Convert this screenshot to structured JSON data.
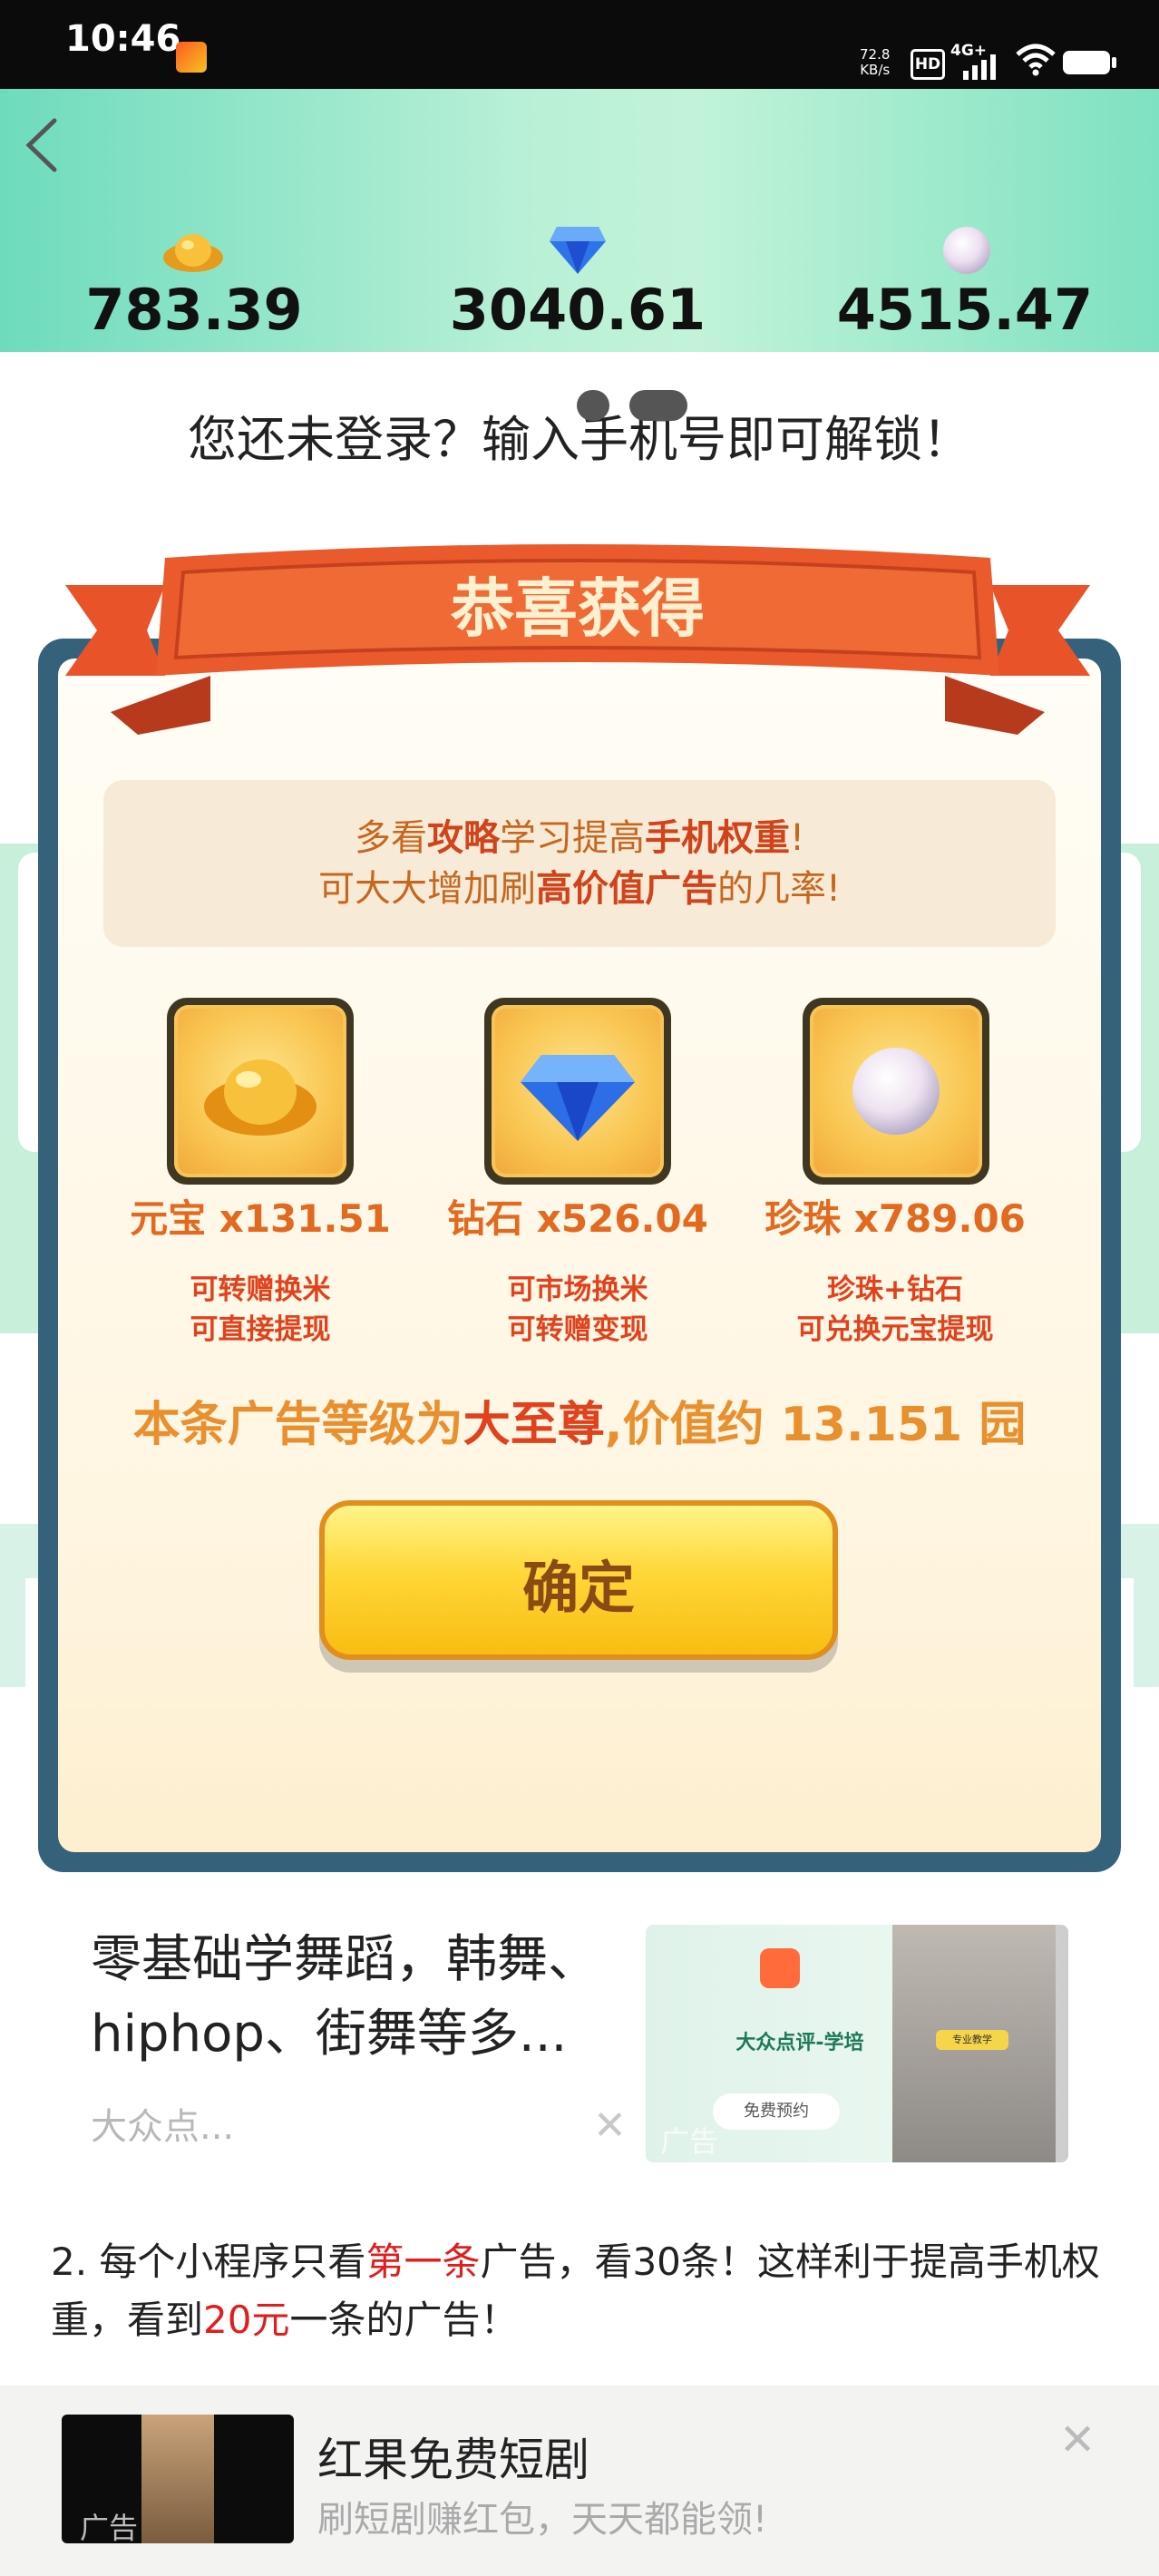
{
  "status_bar": {
    "time": "10:46",
    "net_speed_value": "72.8",
    "net_speed_unit": "KB/s",
    "hd_badge": "HD",
    "network": "4G+",
    "icons": [
      "app-notification-icon",
      "signal-icon",
      "wifi-icon",
      "battery-icon"
    ]
  },
  "header": {
    "back_icon": "chevron-left-icon",
    "balances": [
      {
        "icon": "gold-ingot-icon",
        "value": "783.39"
      },
      {
        "icon": "diamond-icon",
        "value": "3040.61"
      },
      {
        "icon": "pearl-icon",
        "value": "4515.47"
      }
    ],
    "colors": {
      "gradient_start": "#6edbbd",
      "gradient_end": "#7ee1c1"
    }
  },
  "login_prompt": "您还未登录？输入手机号即可解锁！",
  "modal": {
    "title": "恭喜获得",
    "tip_parts": [
      {
        "text": "多看",
        "hl": false
      },
      {
        "text": "攻略",
        "hl": true
      },
      {
        "text": "学习提高",
        "hl": false
      },
      {
        "text": "手机权重",
        "hl": true
      },
      {
        "text": "!",
        "hl": false
      }
    ],
    "tip_parts_2": [
      {
        "text": "可大大增加刷",
        "hl": false
      },
      {
        "text": "高价值广告",
        "hl": true
      },
      {
        "text": "的几率!",
        "hl": false
      }
    ],
    "rewards": [
      {
        "icon": "gold-ingot-icon",
        "name": "元宝",
        "amount": "x131.51",
        "desc1": "可转赠换米",
        "desc2": "可直接提现"
      },
      {
        "icon": "diamond-icon",
        "name": "钻石",
        "amount": "x526.04",
        "desc1": "可市场换米",
        "desc2": "可转赠变现"
      },
      {
        "icon": "pearl-icon",
        "name": "珍珠",
        "amount": "x789.06",
        "desc1": "珍珠+钻石",
        "desc2": "可兑换元宝提现"
      }
    ],
    "value_prefix": "本条广告等级为",
    "value_level": "大至尊",
    "value_suffix": ",价值约 13.151 园",
    "confirm_label": "确定",
    "colors": {
      "frame": "#35617a",
      "ribbon": "#e8532a",
      "title_text": "#fff1cf",
      "button": "#ffd738"
    }
  },
  "ad_card": {
    "title": "零基础学舞蹈，韩舞、hiphop、街舞等多...",
    "source": "大众点...",
    "close": "✕",
    "image_caption": "大众点评-学培",
    "image_button": "免费预约",
    "image_ad_tag": "广告",
    "image_person_tag": "专业教学"
  },
  "instructions": {
    "prefix": "2. 每个小程序只看",
    "hl1": "第一条",
    "mid": "广告，看30条！这样利于提高手机权重，看到",
    "hl2": "20元",
    "suffix": "一条的广告！"
  },
  "bottom_banner": {
    "title": "红果免费短剧",
    "subtitle": "刷短剧赚红包，天天都能领!",
    "ad_tag": "广告",
    "close": "✕"
  }
}
